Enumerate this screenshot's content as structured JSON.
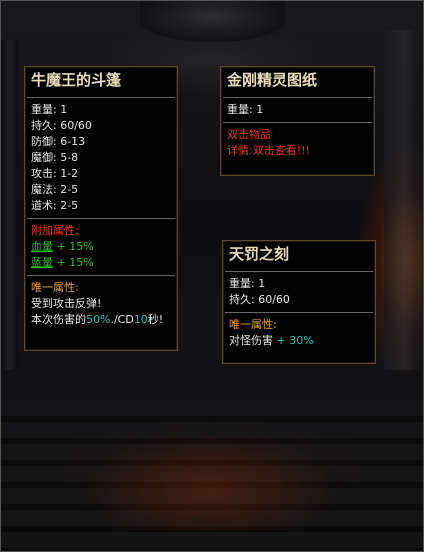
{
  "tooltip_a": {
    "title": "牛魔王的斗篷",
    "stats": [
      {
        "label": "重量:",
        "value": "1"
      },
      {
        "label": "持久:",
        "value": "60/60"
      },
      {
        "label": "防御:",
        "value": "6-13"
      },
      {
        "label": "魔御:",
        "value": "5-8"
      },
      {
        "label": "攻击:",
        "value": "1-2"
      },
      {
        "label": "魔法:",
        "value": "2-5"
      },
      {
        "label": "道术:",
        "value": "2-5"
      }
    ],
    "extra_header": "附加属性:",
    "extra": [
      {
        "label": "血量",
        "value": "+ 15%"
      },
      {
        "label": "蓝量",
        "value": "+ 15%"
      }
    ],
    "unique_header": "唯一属性:",
    "unique_line1": "受到攻击反弹!",
    "unique_line2_pre": "本次伤害的",
    "unique_line2_pct": "50%",
    "unique_line2_mid": "./CD",
    "unique_line2_cd": "10",
    "unique_line2_post": "秒!"
  },
  "tooltip_b": {
    "title": "金刚精灵图纸",
    "weight_label": "重量:",
    "weight_value": "1",
    "action_line1": "双击物品",
    "action_line2": "详情:双击查看!!!"
  },
  "tooltip_c": {
    "title": "天罚之刻",
    "weight_label": "重量:",
    "weight_value": "1",
    "durability_label": "持久:",
    "durability_value": "60/60",
    "unique_header": "唯一属性:",
    "unique_label": "对怪伤害",
    "unique_value": "+ 30%"
  }
}
